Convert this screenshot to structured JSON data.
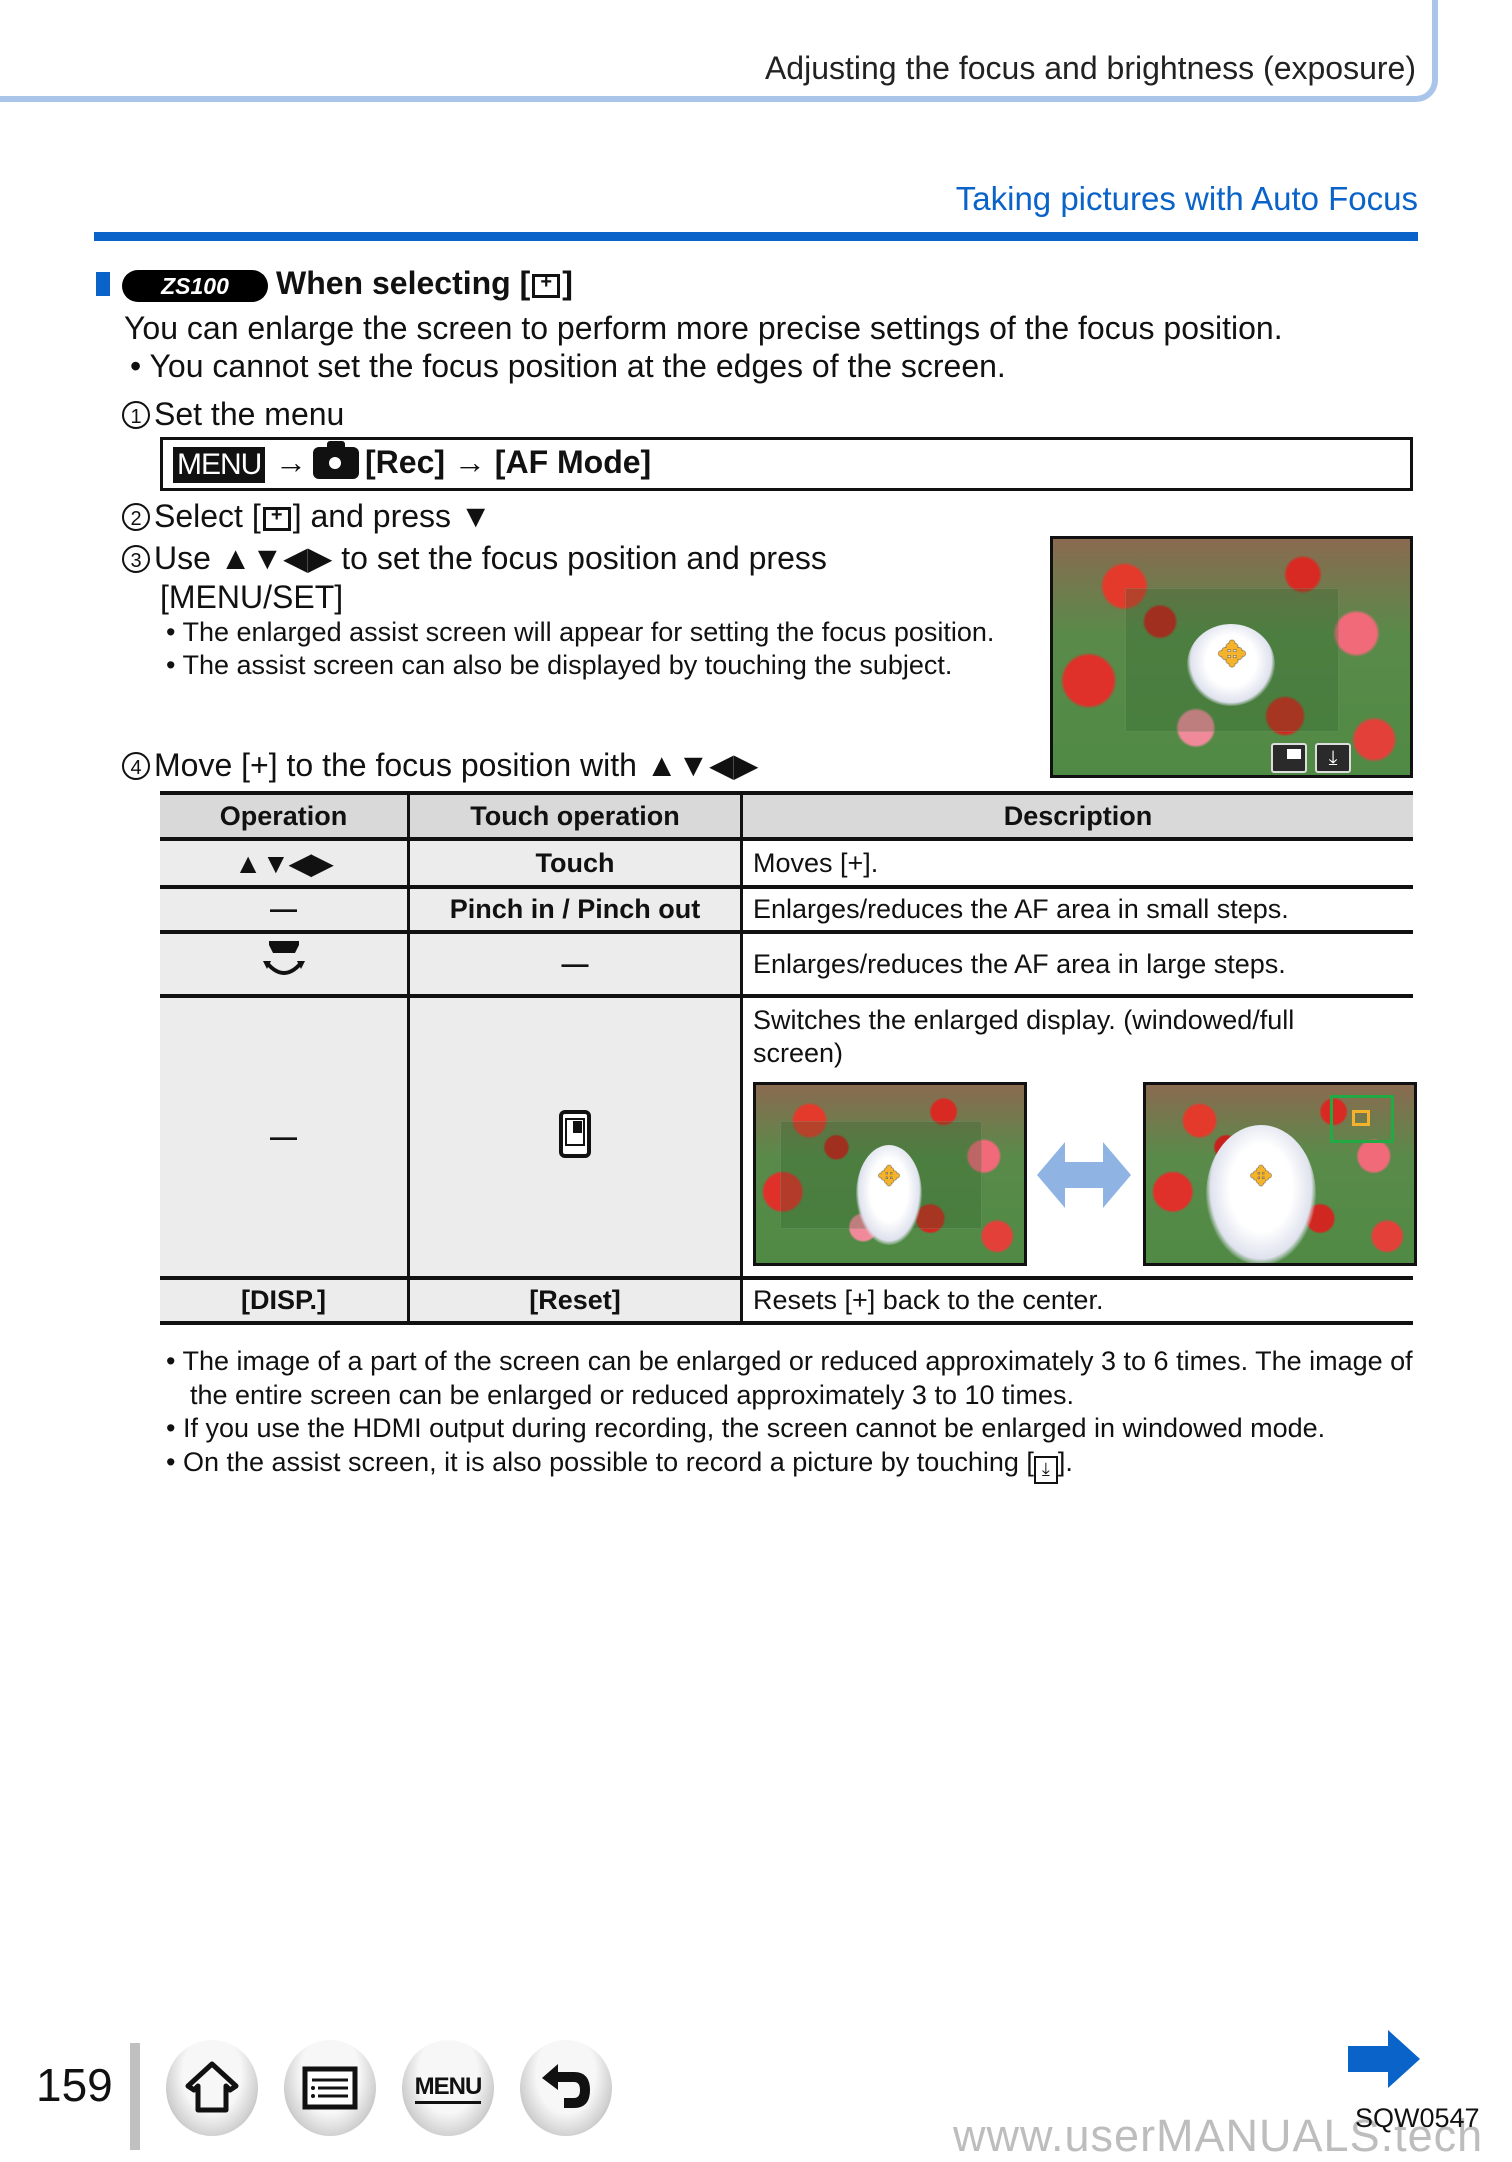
{
  "header": {
    "title": "Adjusting the focus and brightness (exposure)"
  },
  "section": {
    "title": "Taking pictures with Auto Focus"
  },
  "heading": {
    "model_badge": "ZS100",
    "text_before": "When selecting [",
    "text_after": "]"
  },
  "intro": {
    "text": "You can enlarge the screen to perform more precise settings of the focus position.",
    "bullet": "• You cannot set the focus position at the edges of the screen."
  },
  "steps": {
    "s1": {
      "num": "1",
      "text": "Set the menu"
    },
    "menu_path": {
      "menu_tag": "MENU",
      "arrow1": "→",
      "rec": "[Rec]",
      "arrow2": "→",
      "af_mode": "[AF Mode]"
    },
    "s2": {
      "num": "2",
      "text_before": "Select [",
      "text_after": "] and press ▼"
    },
    "s3": {
      "num": "3",
      "line1": "Use ▲▼◀▶ to set the focus position and press",
      "line2": "[MENU/SET]",
      "bullets": [
        "The enlarged assist screen will appear for setting the focus position.",
        "The assist screen can also be displayed by touching the subject."
      ]
    },
    "s4": {
      "num": "4",
      "text": "Move [+] to the focus position with ▲▼◀▶"
    }
  },
  "table": {
    "headers": [
      "Operation",
      "Touch operation",
      "Description"
    ],
    "rows": [
      {
        "operation": "▲▼◀▶",
        "touch": "Touch",
        "description": "Moves [+]."
      },
      {
        "operation": "—",
        "touch": "Pinch in / Pinch out",
        "description": "Enlarges/reduces the AF area in small steps."
      },
      {
        "operation": "control-dial-icon",
        "touch": "—",
        "description": "Enlarges/reduces the AF area in large steps."
      },
      {
        "operation": "—",
        "touch": "window-toggle-icon",
        "description": "Switches the enlarged display. (windowed/full screen)"
      },
      {
        "operation": "[DISP.]",
        "touch": "[Reset]",
        "description": "Resets [+] back to the center."
      }
    ]
  },
  "notes": [
    "The image of a part of the screen can be enlarged or reduced approximately 3 to 6 times. The image of the entire screen can be enlarged or reduced approximately 3 to 10 times.",
    "If you use the HDMI output during recording, the screen cannot be enlarged in windowed mode.",
    "On the assist screen, it is also possible to record a picture by touching ["
  ],
  "notes_tail": "].",
  "footer": {
    "page_number": "159",
    "nav": [
      {
        "icon": "home-icon"
      },
      {
        "icon": "contents-list-icon"
      },
      {
        "icon": "menu-icon",
        "label": "MENU"
      },
      {
        "icon": "back-icon"
      }
    ],
    "doc_code": "SQW0547",
    "watermark": "www.userMANUALS.tech"
  },
  "colors": {
    "accent_blue": "#0a63c8",
    "header_border": "#a9c6ea",
    "af_orange": "#f4b32a",
    "table_header_bg": "#d9d9d9"
  }
}
